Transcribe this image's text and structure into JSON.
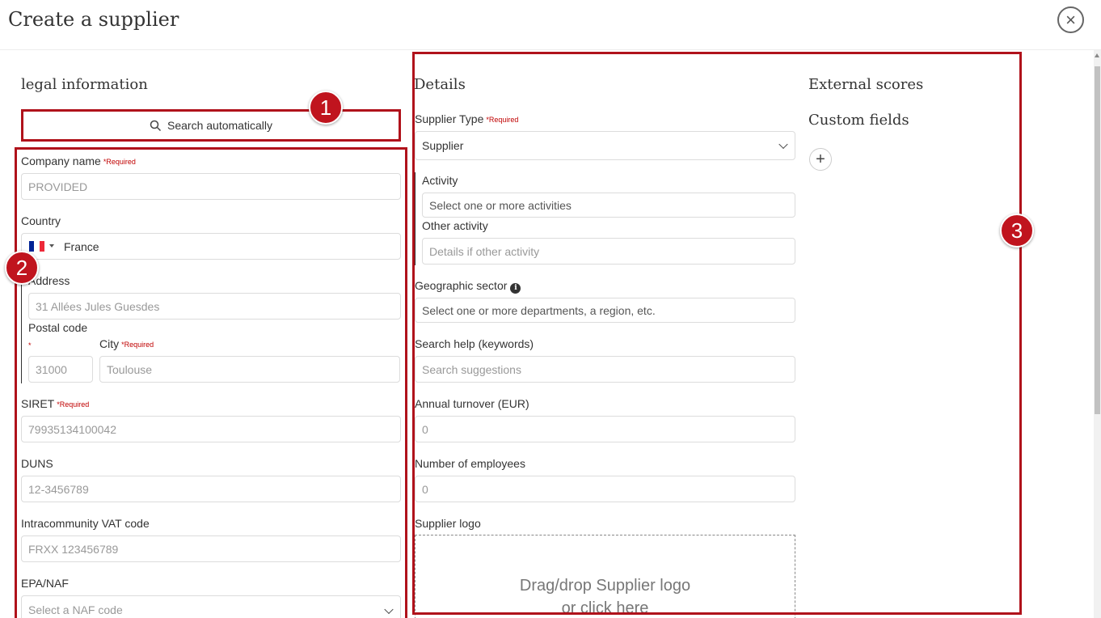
{
  "header": {
    "title": "Create a supplier"
  },
  "legal": {
    "title": "legal information",
    "search_button": "Search automatically",
    "company_name": {
      "label": "Company name",
      "required": "*Required",
      "placeholder": "PROVIDED"
    },
    "country": {
      "label": "Country",
      "value": "France"
    },
    "address": {
      "label": "Address",
      "placeholder": "31 Allées Jules Guesdes"
    },
    "postal_code": {
      "label": "Postal code",
      "required": "*",
      "placeholder": "31000"
    },
    "city": {
      "label": "City",
      "required": "*Required",
      "placeholder": "Toulouse"
    },
    "siret": {
      "label": "SIRET",
      "required": "*Required",
      "placeholder": "79935134100042"
    },
    "duns": {
      "label": "DUNS",
      "placeholder": "12-3456789"
    },
    "vat": {
      "label": "Intracommunity VAT code",
      "placeholder": "FRXX 123456789"
    },
    "naf": {
      "label": "EPA/NAF",
      "placeholder": "Select a NAF code"
    }
  },
  "details": {
    "title": "Details",
    "supplier_type": {
      "label": "Supplier Type",
      "required": "*Required",
      "value": "Supplier"
    },
    "activity": {
      "label": "Activity",
      "placeholder": "Select one or more activities"
    },
    "other_activity": {
      "label": "Other activity",
      "placeholder": "Details if other activity"
    },
    "geo_sector": {
      "label": "Geographic sector",
      "placeholder": "Select one or more departments, a region, etc."
    },
    "search_help": {
      "label": "Search help (keywords)",
      "placeholder": "Search suggestions"
    },
    "turnover": {
      "label": "Annual turnover (EUR)",
      "placeholder": "0"
    },
    "employees": {
      "label": "Number of employees",
      "placeholder": "0"
    },
    "logo": {
      "label": "Supplier logo",
      "drop_line1": "Drag/drop Supplier logo",
      "drop_line2": "or click here"
    }
  },
  "right": {
    "external_scores": "External scores",
    "custom_fields": "Custom fields",
    "add_symbol": "+"
  },
  "annotations": {
    "badge1": "1",
    "badge2": "2",
    "badge3": "3",
    "color": "#b0121b"
  },
  "flag_colors": [
    "#002395",
    "#ffffff",
    "#ed2939"
  ]
}
